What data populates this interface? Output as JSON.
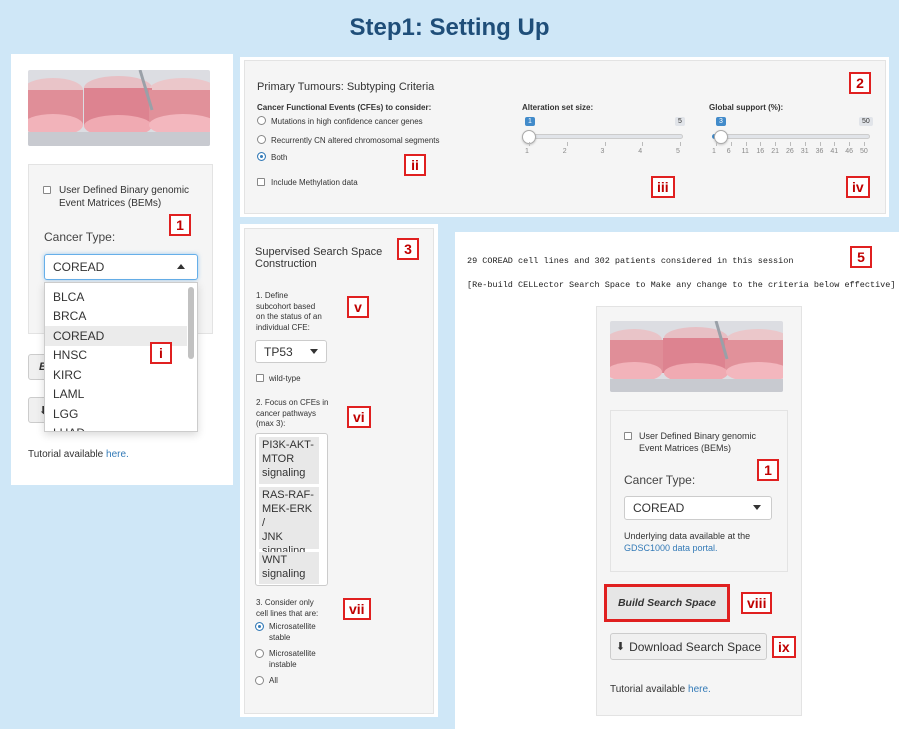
{
  "page_title": "Step1: Setting Up",
  "colors": {
    "accent": "#337ab7",
    "callout": "#e02020",
    "arrow": "#1e90ff",
    "title": "#1f4e79"
  },
  "left_panel": {
    "bem_label_line1": "User Defined Binary genomic",
    "bem_label_line2": "Event Matrices (BEMs)",
    "cancer_type_label": "Cancer Type:",
    "cancer_type_value": "COREAD",
    "dropdown_options": [
      "BLCA",
      "BRCA",
      "COREAD",
      "HNSC",
      "KIRC",
      "LAML",
      "LGG",
      "LUAD"
    ],
    "tutorial_prefix": "Tutorial available ",
    "tutorial_link": "here.",
    "hidden_button_fragment": "B",
    "callout_1": "1",
    "callout_i": "i"
  },
  "criteria_panel": {
    "heading": "Primary Tumours: Subtyping Criteria",
    "cfe_label": "Cancer Functional Events (CFEs) to consider:",
    "options": [
      "Mutations in high confidence cancer genes",
      "Recurrently CN altered chromosomal segments",
      "Both"
    ],
    "selected_option": "Both",
    "methylation_label": "Include Methylation data",
    "alteration_label": "Alteration set size:",
    "alteration_value": "1",
    "alteration_max": "5",
    "alteration_ticks": [
      "1",
      "2",
      "3",
      "4",
      "5"
    ],
    "support_label": "Global support (%):",
    "support_value": "3",
    "support_max": "50",
    "support_ticks": [
      "1",
      "6",
      "11",
      "16",
      "21",
      "26",
      "31",
      "36",
      "41",
      "46",
      "50"
    ],
    "callout_2": "2",
    "callout_ii": "ii",
    "callout_iii": "iii",
    "callout_iv": "iv"
  },
  "supervised_panel": {
    "heading_line1": "Supervised Search Space",
    "heading_line2": "Construction",
    "step1_lines": [
      "1. Define",
      "subcohort based",
      "on the status of an",
      "individual CFE:"
    ],
    "cfe_select": "TP53",
    "wildtype_label": "wild-type",
    "step2_lines": [
      "2. Focus on CFEs in",
      "cancer pathways",
      "(max 3):"
    ],
    "pathways": [
      {
        "lines": [
          "PI3K-AKT-",
          "MTOR",
          "signaling"
        ]
      },
      {
        "lines": [
          "RAS-RAF-",
          "MEK-ERK /",
          "JNK",
          "signaling"
        ]
      },
      {
        "lines": [
          "WNT",
          "signaling"
        ]
      }
    ],
    "step3_lines": [
      "3. Consider only",
      "cell lines that are:"
    ],
    "msi_options": [
      {
        "lines": [
          "Microsatellite",
          "stable"
        ]
      },
      {
        "lines": [
          "Microsatellite",
          "instable"
        ]
      },
      {
        "lines": [
          "All"
        ]
      }
    ],
    "callout_3": "3",
    "callout_v": "v",
    "callout_vi": "vi",
    "callout_vii": "vii"
  },
  "result_panel": {
    "session_line": "29 COREAD cell lines and  302 patients considered in this session",
    "rebuild_line": "[Re-build CELLector Search Space to Make any change to the criteria below effective]",
    "bem_label_line1": "User Defined Binary genomic",
    "bem_label_line2": "Event Matrices (BEMs)",
    "cancer_type_label": "Cancer Type:",
    "cancer_type_value": "COREAD",
    "underlying_text": "Underlying data available at the",
    "portal_link": "GDSC1000 data portal.",
    "build_button": "Build Search Space",
    "download_button": "Download Search Space",
    "tutorial_prefix": "Tutorial available ",
    "tutorial_link": "here.",
    "callout_5": "5",
    "callout_1": "1",
    "callout_viii": "viii",
    "callout_ix": "ix"
  }
}
